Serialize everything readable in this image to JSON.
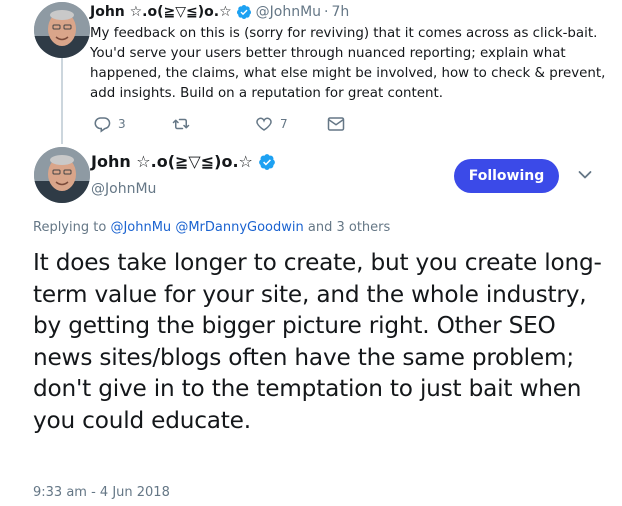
{
  "parent_tweet": {
    "author_name": "John ☆.o(≧▽≦)o.☆",
    "handle": "@JohnMu",
    "separator": "·",
    "time": "7h",
    "text": "My feedback on this is (sorry for reviving) that it comes across as click-bait. You'd serve your users better through nuanced reporting; explain what happened, the claims, what else might be involved, how to check & prevent, add insights. Build on a reputation for great content.",
    "reply_count": "3",
    "like_count": "7",
    "icons": [
      "reply-icon",
      "retweet-icon",
      "like-icon",
      "direct-message-icon"
    ]
  },
  "main_tweet": {
    "author_name": "John ☆.o(≧▽≦)o.☆",
    "handle": "@JohnMu",
    "follow_label": "Following",
    "replying_prefix": "Replying to",
    "replying_user1": "@JohnMu",
    "replying_user2": "@MrDannyGoodwin",
    "replying_suffix": "and 3 others",
    "text": "It does take longer to create, but you create long-term value for your site, and the whole industry, by getting the bigger picture right. Other SEO news sites/blogs often have the same problem; don't give in to the temptation to just bait when you could educate.",
    "timestamp": "9:33 am - 4 Jun 2018"
  },
  "colors": {
    "accent": "#3b4ae8",
    "link": "#1b63d0",
    "muted": "#657786",
    "verified": "#1da1f2",
    "thread_line": "#ccd6dd"
  }
}
